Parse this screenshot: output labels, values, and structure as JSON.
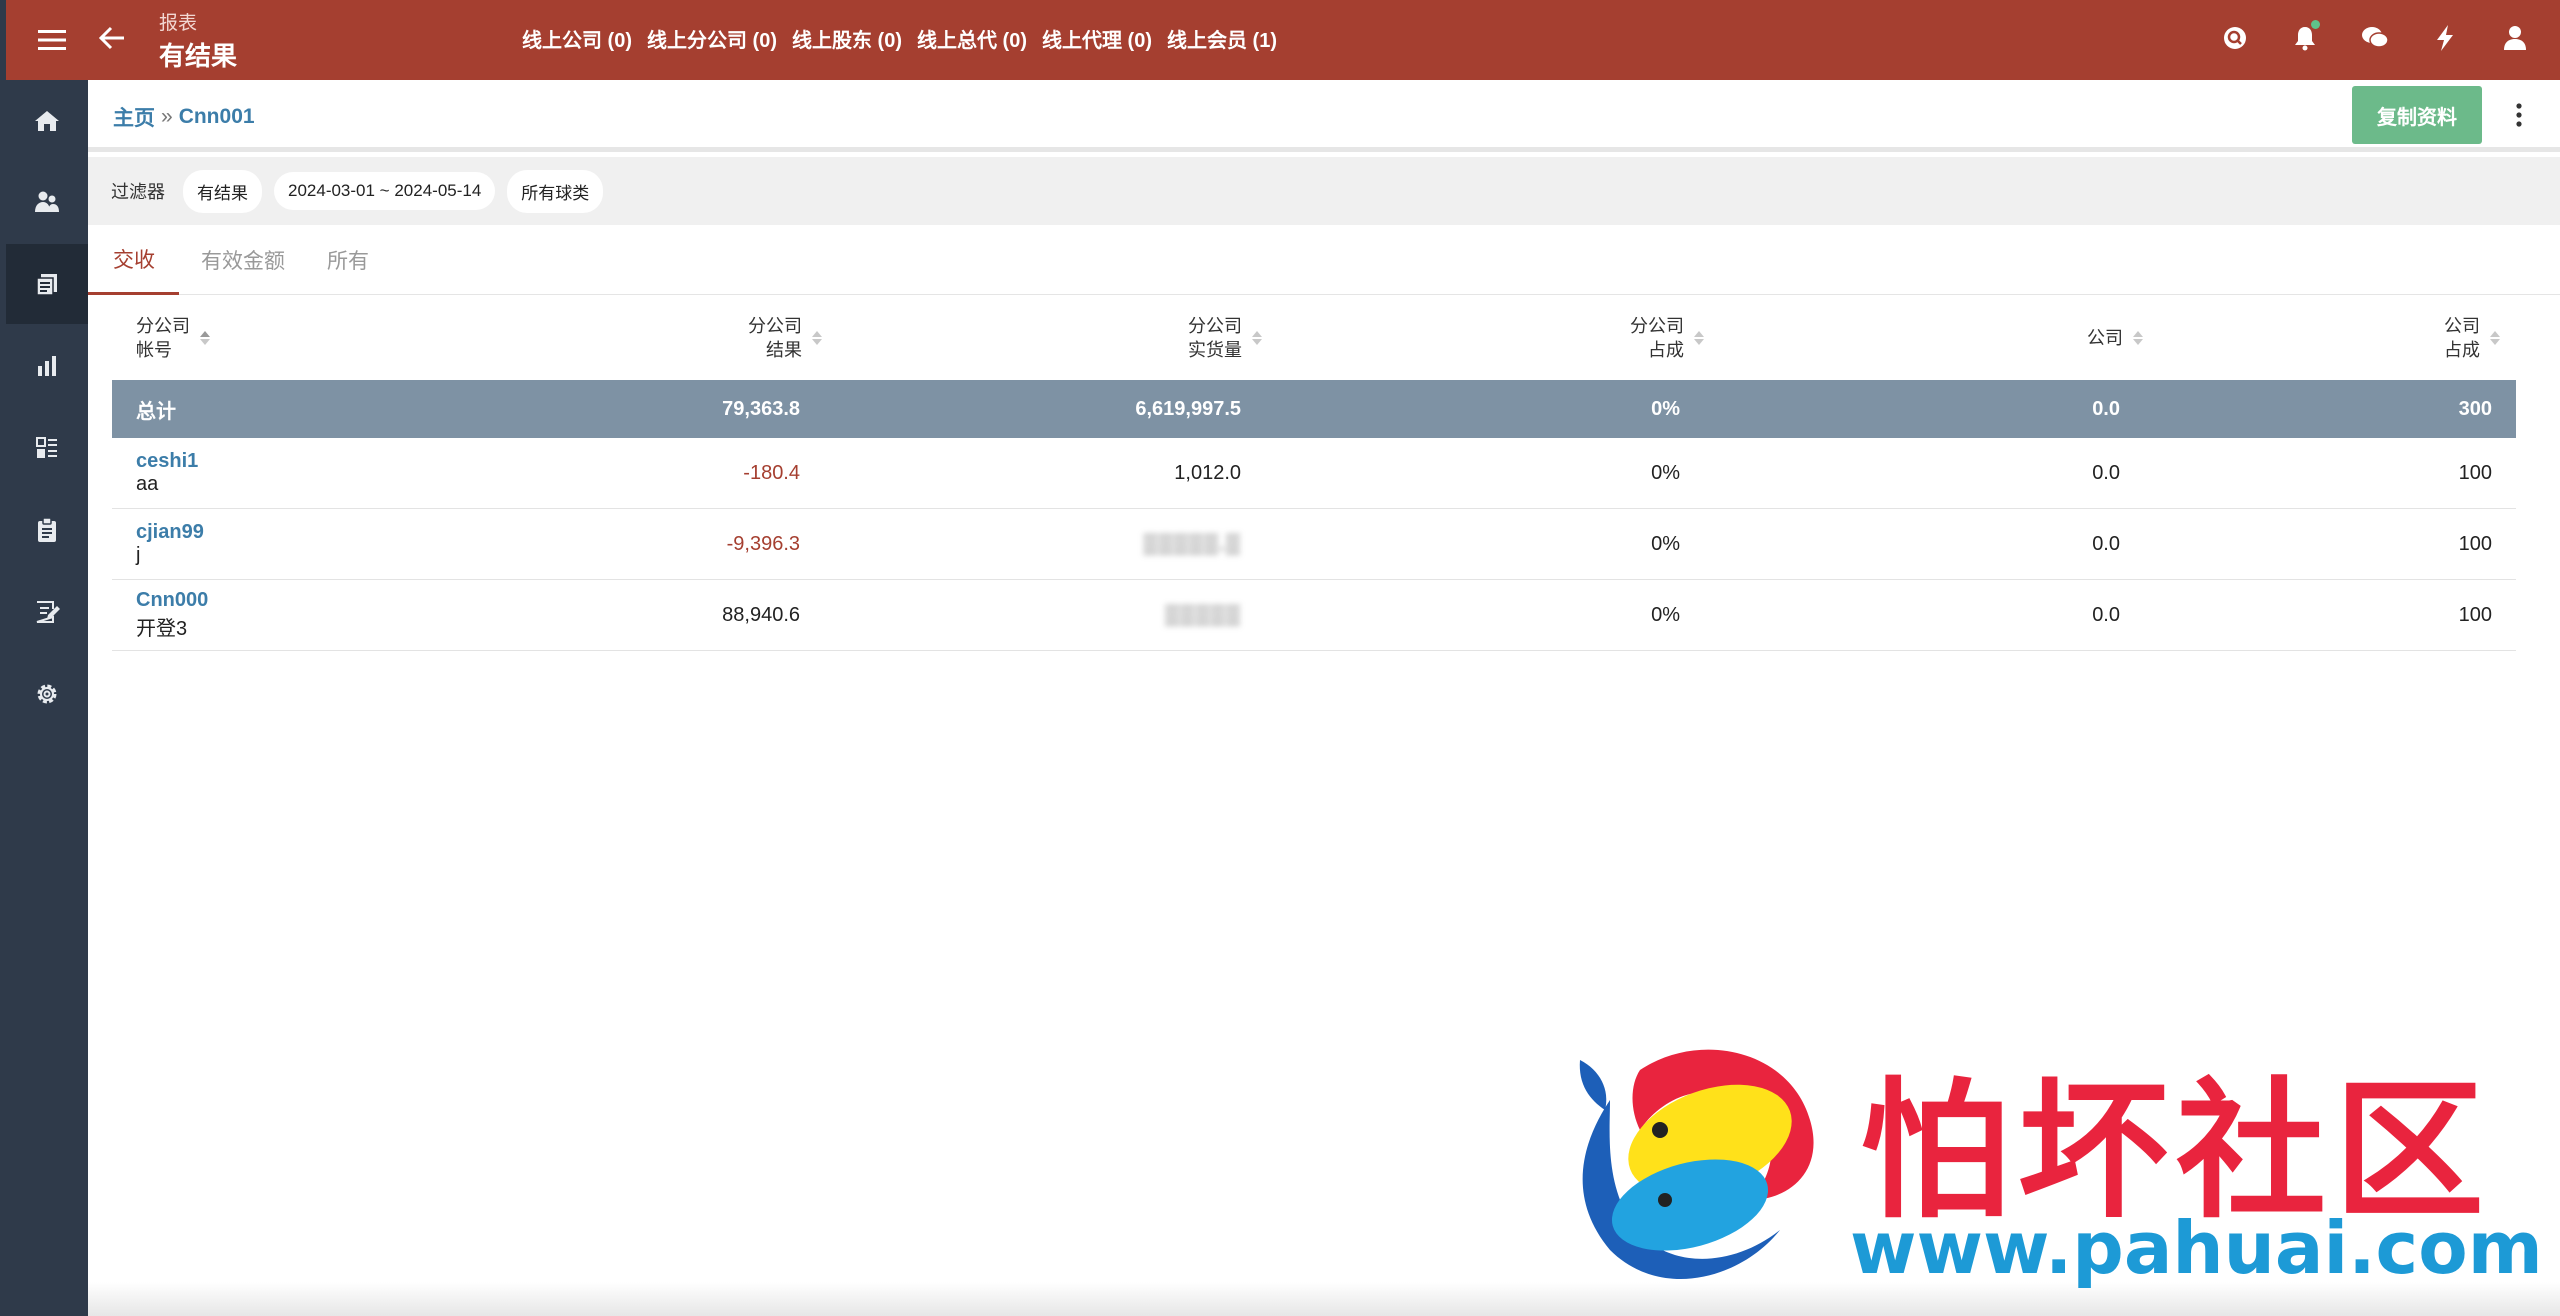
{
  "header": {
    "section": "报表",
    "title": "有结果",
    "nav": [
      {
        "label": "线上公司 (0)"
      },
      {
        "label": "线上分公司 (0)"
      },
      {
        "label": "线上股东 (0)"
      },
      {
        "label": "线上总代 (0)"
      },
      {
        "label": "线上代理 (0)"
      },
      {
        "label": "线上会员 (1)"
      }
    ],
    "icons": [
      "search-icon",
      "bell-icon",
      "chat-icon",
      "bolt-icon",
      "user-icon"
    ],
    "badge_color": "#5fc38a"
  },
  "sidebar": {
    "items": [
      {
        "icon": "home-icon"
      },
      {
        "icon": "users-icon"
      },
      {
        "icon": "reports-icon",
        "active": true
      },
      {
        "icon": "bar-chart-icon"
      },
      {
        "icon": "list-icon"
      },
      {
        "icon": "clipboard-icon"
      },
      {
        "icon": "edit-note-icon"
      },
      {
        "icon": "settings-icon"
      }
    ]
  },
  "breadcrumb": {
    "home": "主页",
    "sep": "»",
    "current": "Cnn001"
  },
  "toolbar": {
    "copy_label": "复制资料"
  },
  "filters": {
    "label": "过滤器",
    "chips": [
      "有结果",
      "2024-03-01 ~ 2024-05-14",
      "所有球类"
    ]
  },
  "tabs": [
    {
      "label": "交收",
      "active": true
    },
    {
      "label": "有效金额"
    },
    {
      "label": "所有"
    }
  ],
  "table": {
    "headers": [
      {
        "line1": "分公司",
        "line2": "帐号"
      },
      {
        "line1": "分公司",
        "line2": "结果"
      },
      {
        "line1": "分公司",
        "line2": "实货量"
      },
      {
        "line1": "分公司",
        "line2": "占成"
      },
      {
        "line1": "公司",
        "line2": ""
      },
      {
        "line1": "公司",
        "line2": "占成"
      }
    ],
    "total": {
      "label": "总计",
      "result": "79,363.8",
      "volume": "6,619,997.5",
      "share": "0%",
      "company": "0.0",
      "company_share": "300"
    },
    "rows": [
      {
        "id": "ceshi1",
        "name": "aa",
        "result": "-180.4",
        "negative": true,
        "volume": "1,012.0",
        "blurred": false,
        "share": "0%",
        "company": "0.0",
        "company_share": "100"
      },
      {
        "id": "cjian99",
        "name": "j",
        "result": "-9,396.3",
        "negative": true,
        "volume": "▒▒▒▒▒.▒",
        "blurred": true,
        "share": "0%",
        "company": "0.0",
        "company_share": "100"
      },
      {
        "id": "Cnn000",
        "name": "开登3",
        "result": "88,940.6",
        "negative": false,
        "volume": "▒▒▒▒▒",
        "blurred": true,
        "share": "0%",
        "company": "0.0",
        "company_share": "100"
      }
    ]
  },
  "watermark": {
    "text": "怕坏社区",
    "url": "www.pahuai.com"
  },
  "colors": {
    "header": "#a53f30",
    "sidebar": "#2f3a4a",
    "accent_link": "#3c7da9",
    "total_row": "#7e92a4",
    "copy_button": "#6cba8a"
  }
}
